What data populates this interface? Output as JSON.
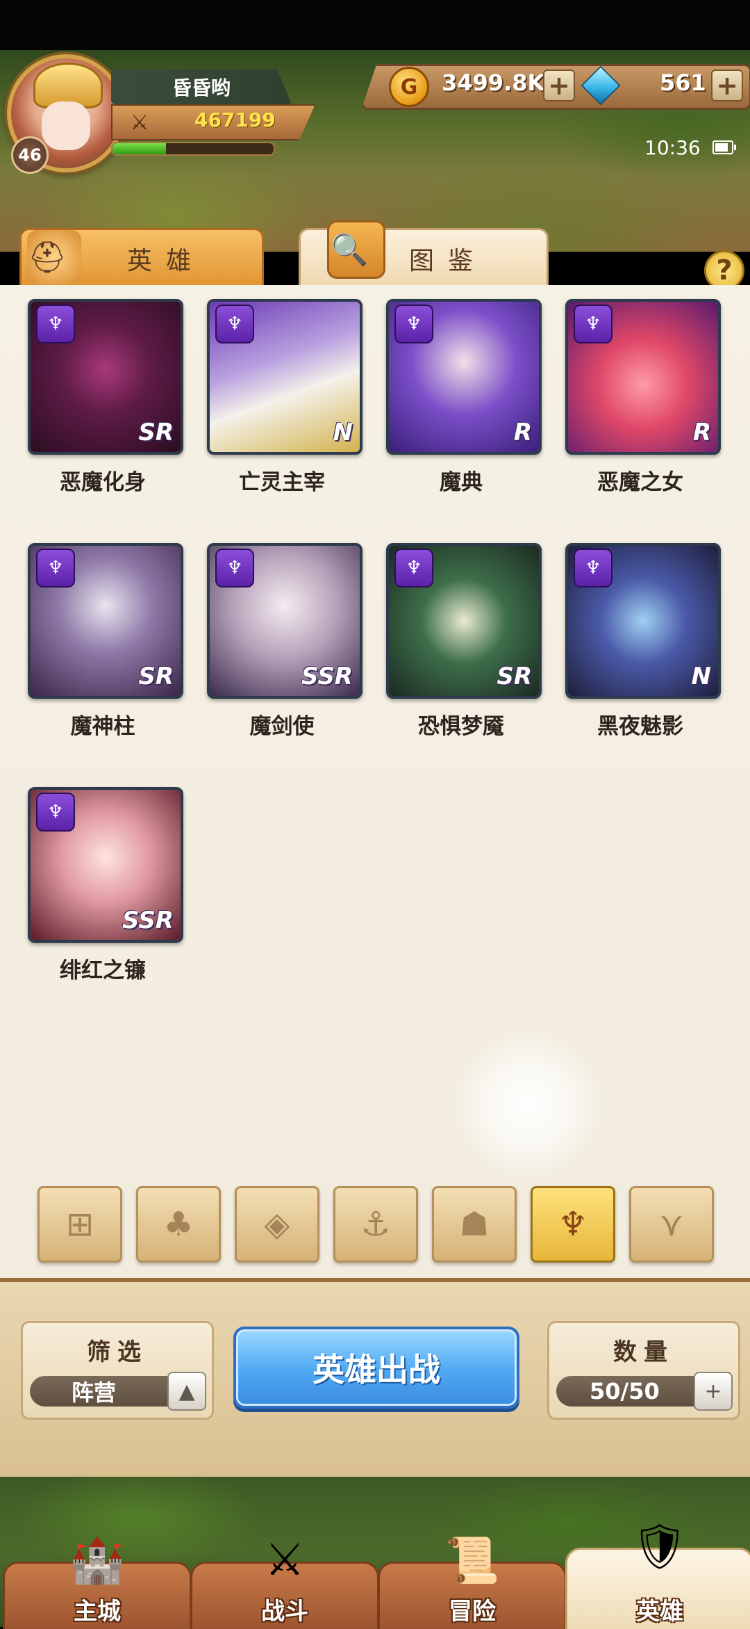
{
  "player": {
    "name": "昏昏哟",
    "level": "46",
    "power": "467199",
    "xp_fraction": 0.33
  },
  "currency": {
    "gold": "3499.8K",
    "gems": "561",
    "plus": "+"
  },
  "status": {
    "time": "10:36"
  },
  "tabs": [
    {
      "label": "英雄",
      "active": false
    },
    {
      "label": "图鉴",
      "active": true
    }
  ],
  "help_label": "?",
  "heroes": [
    {
      "name": "恶魔化身",
      "rarity": "SR",
      "faction_icon": "demon-horns-icon"
    },
    {
      "name": "亡灵主宰",
      "rarity": "N",
      "faction_icon": "demon-horns-icon"
    },
    {
      "name": "魔典",
      "rarity": "R",
      "faction_icon": "demon-horns-icon"
    },
    {
      "name": "恶魔之女",
      "rarity": "R",
      "faction_icon": "demon-horns-icon"
    },
    {
      "name": "魔神柱",
      "rarity": "SR",
      "faction_icon": "demon-horns-icon"
    },
    {
      "name": "魔剑使",
      "rarity": "SSR",
      "faction_icon": "demon-horns-icon"
    },
    {
      "name": "恐惧梦魇",
      "rarity": "SR",
      "faction_icon": "demon-horns-icon"
    },
    {
      "name": "黑夜魅影",
      "rarity": "N",
      "faction_icon": "demon-horns-icon"
    },
    {
      "name": "绯红之镰",
      "rarity": "SSR",
      "faction_icon": "demon-horns-icon"
    }
  ],
  "faction_filters": [
    {
      "icon": "grid-all-icon",
      "active": false
    },
    {
      "icon": "leaf-nature-icon",
      "active": false
    },
    {
      "icon": "diamond-order-icon",
      "active": false
    },
    {
      "icon": "anchor-icon",
      "active": false
    },
    {
      "icon": "beast-head-icon",
      "active": false
    },
    {
      "icon": "demon-horns-icon",
      "active": true
    },
    {
      "icon": "chevron-wings-icon",
      "active": false
    }
  ],
  "filter_panel": {
    "title": "筛选",
    "value": "阵营",
    "toggle_icon": "chevron-up-icon"
  },
  "deploy_button": "英雄出战",
  "count_panel": {
    "title": "数量",
    "value": "50/50",
    "plus": "+"
  },
  "bottom_nav": [
    {
      "label": "主城",
      "icon": "castle-icon",
      "active": false
    },
    {
      "label": "战斗",
      "icon": "crossed-swords-icon",
      "active": false
    },
    {
      "label": "冒险",
      "icon": "scroll-map-icon",
      "active": false
    },
    {
      "label": "英雄",
      "icon": "hero-helmet-icon",
      "active": true
    }
  ],
  "colors": {
    "faction_purple": "#6b2fc2",
    "deploy_blue": "#4fa8f2",
    "gold_text": "#ffe34a",
    "tab_orange": "#e8a03f"
  }
}
